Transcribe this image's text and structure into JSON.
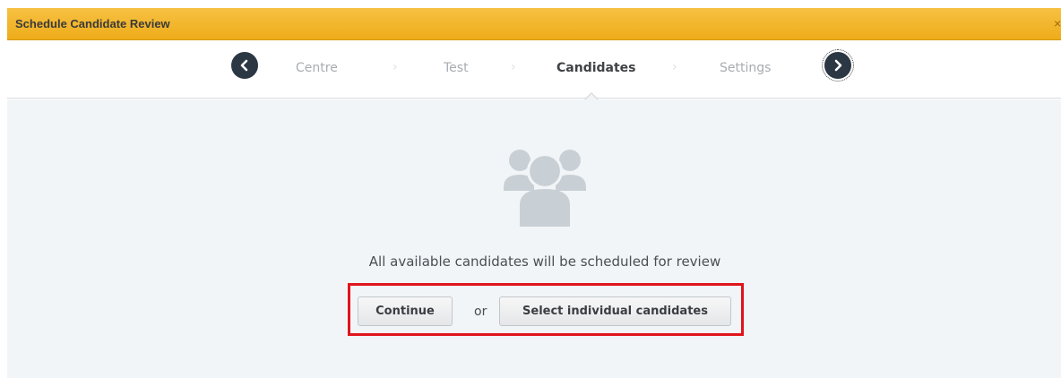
{
  "window": {
    "title": "Schedule Candidate Review",
    "close_glyph": "×"
  },
  "wizard": {
    "steps": [
      {
        "label": "Centre",
        "state": "inactive"
      },
      {
        "label": "Test",
        "state": "inactive"
      },
      {
        "label": "Candidates",
        "state": "active"
      },
      {
        "label": "Settings",
        "state": "inactive"
      }
    ],
    "separator": "›",
    "prev_icon": "chevron-left-icon",
    "next_icon": "chevron-right-icon"
  },
  "main": {
    "icon": "people-group-icon",
    "message": "All available candidates will be scheduled for review",
    "continue_label": "Continue",
    "or_label": "or",
    "select_label": "Select individual candidates"
  },
  "colors": {
    "titlebar": "#eeac1a",
    "nav_button": "#2b3742",
    "highlight_box": "#e0141b",
    "content_bg": "#f2f5f7",
    "icon": "#c9d0d5"
  }
}
